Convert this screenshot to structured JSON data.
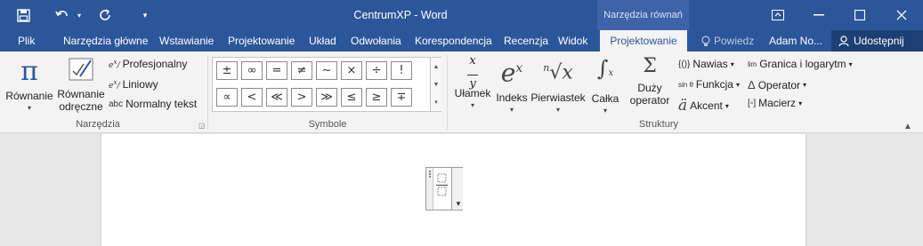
{
  "title_bar": {
    "document_title": "CentrumXP - Word",
    "context_tab_group": "Narzędzia równań",
    "icons": [
      "save-icon",
      "undo-icon",
      "redo-icon",
      "customize-qat-icon",
      "ribbon-display-icon",
      "minimize-icon",
      "maximize-icon",
      "close-icon"
    ]
  },
  "tabs": [
    {
      "label": "Plik"
    },
    {
      "label": "Narzędzia główne"
    },
    {
      "label": "Wstawianie"
    },
    {
      "label": "Projektowanie"
    },
    {
      "label": "Układ"
    },
    {
      "label": "Odwołania"
    },
    {
      "label": "Korespondencja"
    },
    {
      "label": "Recenzja"
    },
    {
      "label": "Widok"
    },
    {
      "label": "Projektowanie"
    }
  ],
  "tell_me": "Powiedz",
  "user": "Adam No...",
  "share": "Udostępnij",
  "ribbon": {
    "tools": {
      "group_label": "Narzędzia",
      "equation_label": "Równanie",
      "ink_equation_line1": "Równanie",
      "ink_equation_line2": "odręczne",
      "professional": "Profesjonalny",
      "linear": "Liniowy",
      "normal_text_prefix": "abc",
      "normal_text": "Normalny tekst"
    },
    "symbols": {
      "group_label": "Symbole",
      "row1": [
        "±",
        "∞",
        "=",
        "≠",
        "~",
        "×",
        "÷",
        "!"
      ],
      "row2": [
        "∝",
        "<",
        "≪",
        ">",
        "≫",
        "≤",
        "≥",
        "∓"
      ]
    },
    "structures": {
      "group_label": "Struktury",
      "fraction": "Ułamek",
      "script": "Indeks",
      "radical": "Pierwiastek",
      "integral": "Całka",
      "large_operator_line1": "Duży",
      "large_operator_line2": "operator",
      "bracket": "Nawias",
      "function": "Funkcja",
      "accent": "Akcent",
      "limit_log": "Granica i logarytm",
      "operator": "Operator",
      "matrix": "Macierz",
      "function_glyph": "sin θ",
      "limit_glyph": "lim"
    }
  }
}
